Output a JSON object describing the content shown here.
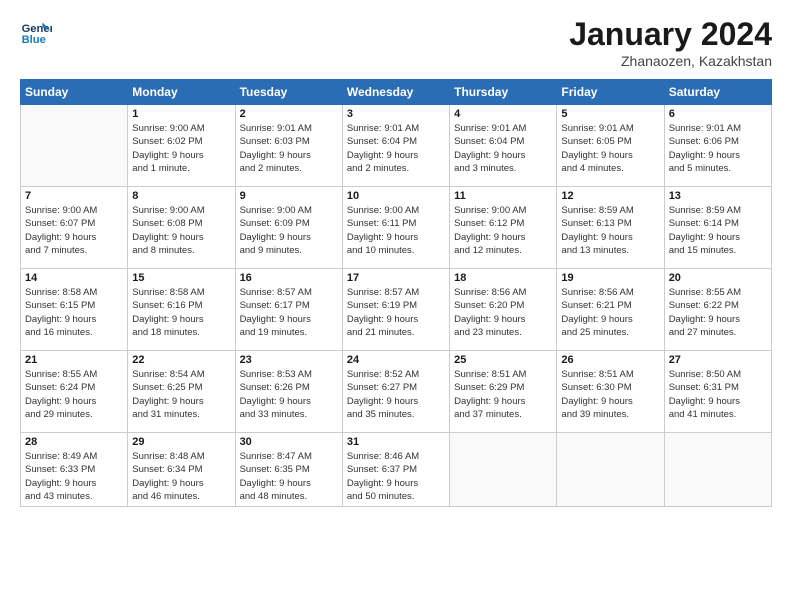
{
  "header": {
    "logo_line1": "General",
    "logo_line2": "Blue",
    "month_title": "January 2024",
    "location": "Zhanaozen, Kazakhstan"
  },
  "weekdays": [
    "Sunday",
    "Monday",
    "Tuesday",
    "Wednesday",
    "Thursday",
    "Friday",
    "Saturday"
  ],
  "weeks": [
    [
      {
        "day": "",
        "info": ""
      },
      {
        "day": "1",
        "info": "Sunrise: 9:00 AM\nSunset: 6:02 PM\nDaylight: 9 hours\nand 1 minute."
      },
      {
        "day": "2",
        "info": "Sunrise: 9:01 AM\nSunset: 6:03 PM\nDaylight: 9 hours\nand 2 minutes."
      },
      {
        "day": "3",
        "info": "Sunrise: 9:01 AM\nSunset: 6:04 PM\nDaylight: 9 hours\nand 2 minutes."
      },
      {
        "day": "4",
        "info": "Sunrise: 9:01 AM\nSunset: 6:04 PM\nDaylight: 9 hours\nand 3 minutes."
      },
      {
        "day": "5",
        "info": "Sunrise: 9:01 AM\nSunset: 6:05 PM\nDaylight: 9 hours\nand 4 minutes."
      },
      {
        "day": "6",
        "info": "Sunrise: 9:01 AM\nSunset: 6:06 PM\nDaylight: 9 hours\nand 5 minutes."
      }
    ],
    [
      {
        "day": "7",
        "info": "Sunrise: 9:00 AM\nSunset: 6:07 PM\nDaylight: 9 hours\nand 7 minutes."
      },
      {
        "day": "8",
        "info": "Sunrise: 9:00 AM\nSunset: 6:08 PM\nDaylight: 9 hours\nand 8 minutes."
      },
      {
        "day": "9",
        "info": "Sunrise: 9:00 AM\nSunset: 6:09 PM\nDaylight: 9 hours\nand 9 minutes."
      },
      {
        "day": "10",
        "info": "Sunrise: 9:00 AM\nSunset: 6:11 PM\nDaylight: 9 hours\nand 10 minutes."
      },
      {
        "day": "11",
        "info": "Sunrise: 9:00 AM\nSunset: 6:12 PM\nDaylight: 9 hours\nand 12 minutes."
      },
      {
        "day": "12",
        "info": "Sunrise: 8:59 AM\nSunset: 6:13 PM\nDaylight: 9 hours\nand 13 minutes."
      },
      {
        "day": "13",
        "info": "Sunrise: 8:59 AM\nSunset: 6:14 PM\nDaylight: 9 hours\nand 15 minutes."
      }
    ],
    [
      {
        "day": "14",
        "info": "Sunrise: 8:58 AM\nSunset: 6:15 PM\nDaylight: 9 hours\nand 16 minutes."
      },
      {
        "day": "15",
        "info": "Sunrise: 8:58 AM\nSunset: 6:16 PM\nDaylight: 9 hours\nand 18 minutes."
      },
      {
        "day": "16",
        "info": "Sunrise: 8:57 AM\nSunset: 6:17 PM\nDaylight: 9 hours\nand 19 minutes."
      },
      {
        "day": "17",
        "info": "Sunrise: 8:57 AM\nSunset: 6:19 PM\nDaylight: 9 hours\nand 21 minutes."
      },
      {
        "day": "18",
        "info": "Sunrise: 8:56 AM\nSunset: 6:20 PM\nDaylight: 9 hours\nand 23 minutes."
      },
      {
        "day": "19",
        "info": "Sunrise: 8:56 AM\nSunset: 6:21 PM\nDaylight: 9 hours\nand 25 minutes."
      },
      {
        "day": "20",
        "info": "Sunrise: 8:55 AM\nSunset: 6:22 PM\nDaylight: 9 hours\nand 27 minutes."
      }
    ],
    [
      {
        "day": "21",
        "info": "Sunrise: 8:55 AM\nSunset: 6:24 PM\nDaylight: 9 hours\nand 29 minutes."
      },
      {
        "day": "22",
        "info": "Sunrise: 8:54 AM\nSunset: 6:25 PM\nDaylight: 9 hours\nand 31 minutes."
      },
      {
        "day": "23",
        "info": "Sunrise: 8:53 AM\nSunset: 6:26 PM\nDaylight: 9 hours\nand 33 minutes."
      },
      {
        "day": "24",
        "info": "Sunrise: 8:52 AM\nSunset: 6:27 PM\nDaylight: 9 hours\nand 35 minutes."
      },
      {
        "day": "25",
        "info": "Sunrise: 8:51 AM\nSunset: 6:29 PM\nDaylight: 9 hours\nand 37 minutes."
      },
      {
        "day": "26",
        "info": "Sunrise: 8:51 AM\nSunset: 6:30 PM\nDaylight: 9 hours\nand 39 minutes."
      },
      {
        "day": "27",
        "info": "Sunrise: 8:50 AM\nSunset: 6:31 PM\nDaylight: 9 hours\nand 41 minutes."
      }
    ],
    [
      {
        "day": "28",
        "info": "Sunrise: 8:49 AM\nSunset: 6:33 PM\nDaylight: 9 hours\nand 43 minutes."
      },
      {
        "day": "29",
        "info": "Sunrise: 8:48 AM\nSunset: 6:34 PM\nDaylight: 9 hours\nand 46 minutes."
      },
      {
        "day": "30",
        "info": "Sunrise: 8:47 AM\nSunset: 6:35 PM\nDaylight: 9 hours\nand 48 minutes."
      },
      {
        "day": "31",
        "info": "Sunrise: 8:46 AM\nSunset: 6:37 PM\nDaylight: 9 hours\nand 50 minutes."
      },
      {
        "day": "",
        "info": ""
      },
      {
        "day": "",
        "info": ""
      },
      {
        "day": "",
        "info": ""
      }
    ]
  ]
}
